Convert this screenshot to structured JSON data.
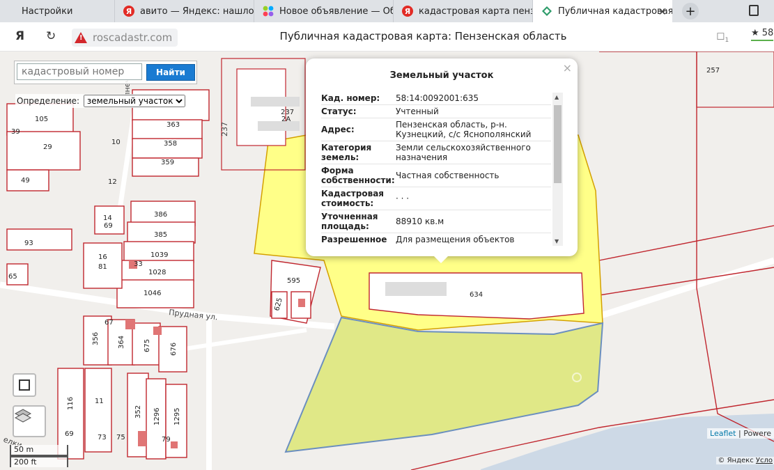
{
  "tabs": [
    {
      "label": "Настройки",
      "icon": "settings-icon",
      "color": "none"
    },
    {
      "label": "авито — Яндекс: нашлось",
      "icon": "yandex-icon",
      "color": "#e22b25"
    },
    {
      "label": "Новое объявление — Обт",
      "icon": "avito-dots-icon",
      "color": "#97cf26"
    },
    {
      "label": "кадастровая карта пензен",
      "icon": "yandex-icon",
      "color": "#e22b25"
    },
    {
      "label": "Публичная кадастровая",
      "icon": "cadastre-icon",
      "color": "#2e7d5a"
    }
  ],
  "address": {
    "url": "roscadastr.com",
    "page_title": "Публичная кадастровая карта: Пензенская область",
    "rating": "★ 58",
    "ext_badge": "1"
  },
  "search": {
    "placeholder": "кадастровый номер",
    "button": "Найти"
  },
  "definition": {
    "label": "Определение:",
    "selected": "земельный участок"
  },
  "popup": {
    "title": "Земельный участок",
    "rows": [
      {
        "k": "Кад. номер:",
        "v": "58:14:0092001:635"
      },
      {
        "k": "Статус:",
        "v": "Учтенный"
      },
      {
        "k": "Адрес:",
        "v": "Пензенская область, р-н. Кузнецкий, с/с Яснополянский"
      },
      {
        "k": "Категория земель:",
        "v": "Земли сельскохозяйственного назначения"
      },
      {
        "k": "Форма собственности:",
        "v": "Частная собственность"
      },
      {
        "k": "Кадастровая стоимость:",
        "v": "· · ·"
      },
      {
        "k": "Уточненная площадь:",
        "v": "88910 кв.м"
      },
      {
        "k": "Разрешенное",
        "v": "Для размещения объектов"
      }
    ]
  },
  "map": {
    "plots": [
      "105",
      "29",
      "49",
      "93",
      "65",
      "363",
      "358",
      "359",
      "386",
      "385",
      "1039",
      "1028",
      "1046",
      "69",
      "81",
      "14",
      "16",
      "10",
      "12",
      "39",
      "595",
      "634",
      "257",
      "237",
      "356",
      "364",
      "675",
      "676",
      "116",
      "11",
      "352",
      "1296",
      "1295",
      "69",
      "73",
      "75",
      "79",
      "625",
      "67"
    ],
    "streets": {
      "solnechnaya": "Солнечная",
      "prudnaya": "Прудная ул.",
      "r237": "237",
      "r2a": "2А",
      "elki": "елки"
    },
    "scale": {
      "metric": "50 m",
      "imperial": "200 ft"
    },
    "attribution": {
      "leaflet": "Leaflet",
      "powered": "| Powere",
      "yandex": "© Яндекс",
      "terms": "Усло"
    }
  }
}
